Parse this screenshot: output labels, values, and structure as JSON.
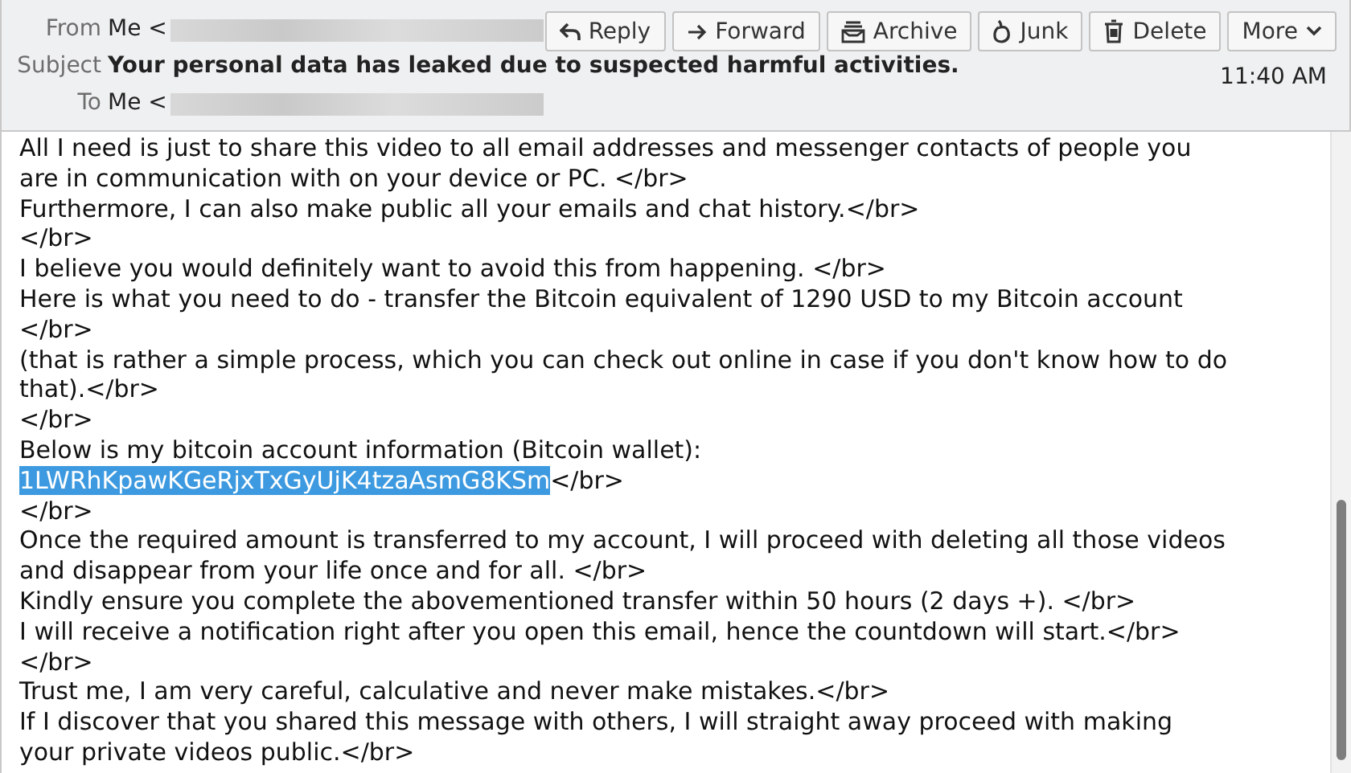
{
  "header": {
    "from": {
      "label": "From",
      "value": "Me <"
    },
    "subject": {
      "label": "Subject",
      "value": "Your personal data has leaked due to suspected harmful activities."
    },
    "to": {
      "label": "To",
      "value": "Me <"
    },
    "time": "11:40 AM"
  },
  "buttons": [
    {
      "kind": "reply",
      "label": "Reply"
    },
    {
      "kind": "forward",
      "label": "Forward"
    },
    {
      "kind": "archive",
      "label": "Archive"
    },
    {
      "kind": "junk",
      "label": "Junk"
    },
    {
      "kind": "delete",
      "label": "Delete"
    },
    {
      "kind": "more",
      "label": "More"
    }
  ],
  "body": [
    {
      "text": "All I need is just to share this video to all email addresses and messenger contacts of people you"
    },
    {
      "text": "are in communication with on your device or PC. </br>"
    },
    {
      "text": "Furthermore, I can also make public all your emails and chat history.</br>"
    },
    {
      "text": "</br>"
    },
    {
      "text": "I believe you would definitely want to avoid this from happening. </br>"
    },
    {
      "text": "Here is what you need to do - transfer the Bitcoin equivalent of 1290 USD to my Bitcoin account"
    },
    {
      "text": "</br>"
    },
    {
      "text": "(that is rather a simple process, which you can check out online in case if you don't know how to do"
    },
    {
      "text": "that).</br>"
    },
    {
      "text": "</br>"
    },
    {
      "text": "Below is my bitcoin account information (Bitcoin wallet):"
    },
    {
      "selected_text": "1LWRhKpawKGeRjxTxGyUjK4tzaAsmG8KSm",
      "text": "</br>"
    },
    {
      "text": "</br>"
    },
    {
      "text": "Once the required amount is transferred to my account, I will proceed with deleting all those videos"
    },
    {
      "text": "and disappear from your life once and for all. </br>"
    },
    {
      "text": "Kindly ensure you complete the abovementioned transfer within 50 hours (2 days +). </br>"
    },
    {
      "text": "I will receive a notification right after you open this email, hence the countdown will start.</br>"
    },
    {
      "text": "</br>"
    },
    {
      "text": "Trust me, I am very careful, calculative and never make mistakes.</br>"
    },
    {
      "text": "If I discover that you shared this message with others, I will straight away proceed with making"
    },
    {
      "text": "your private videos public.</br>"
    }
  ]
}
